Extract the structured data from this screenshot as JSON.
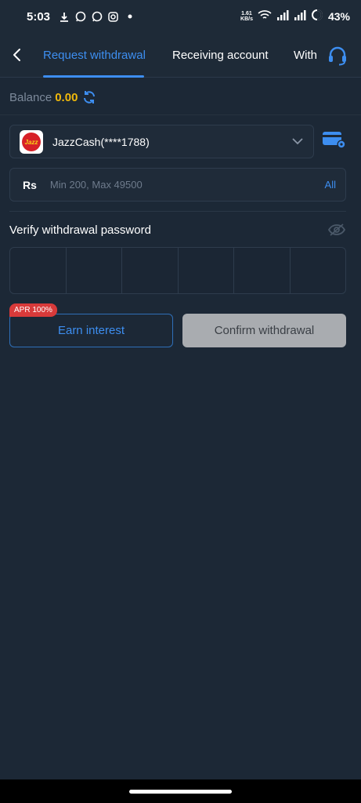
{
  "status_bar": {
    "time": "5:03",
    "net_speed_value": "1.61",
    "net_speed_unit": "KB/s",
    "battery": "43%"
  },
  "nav": {
    "tabs": [
      {
        "label": "Request withdrawal",
        "active": true
      },
      {
        "label": "Receiving account",
        "active": false
      },
      {
        "label": "With",
        "active": false
      }
    ]
  },
  "balance": {
    "label": "Balance",
    "value": "0.00"
  },
  "account": {
    "name": "JazzCash(****1788)",
    "logo_text": "Jazz"
  },
  "amount": {
    "currency": "Rs",
    "placeholder": "Min 200, Max 49500",
    "all_label": "All"
  },
  "password": {
    "label": "Verify withdrawal password",
    "digits": 6
  },
  "actions": {
    "apr_badge": "APR 100%",
    "earn_label": "Earn interest",
    "confirm_label": "Confirm withdrawal"
  },
  "colors": {
    "accent": "#3d8ef0",
    "balance": "#f0b90b",
    "badge": "#d83a3a",
    "disabled_button": "#a9acb0"
  }
}
